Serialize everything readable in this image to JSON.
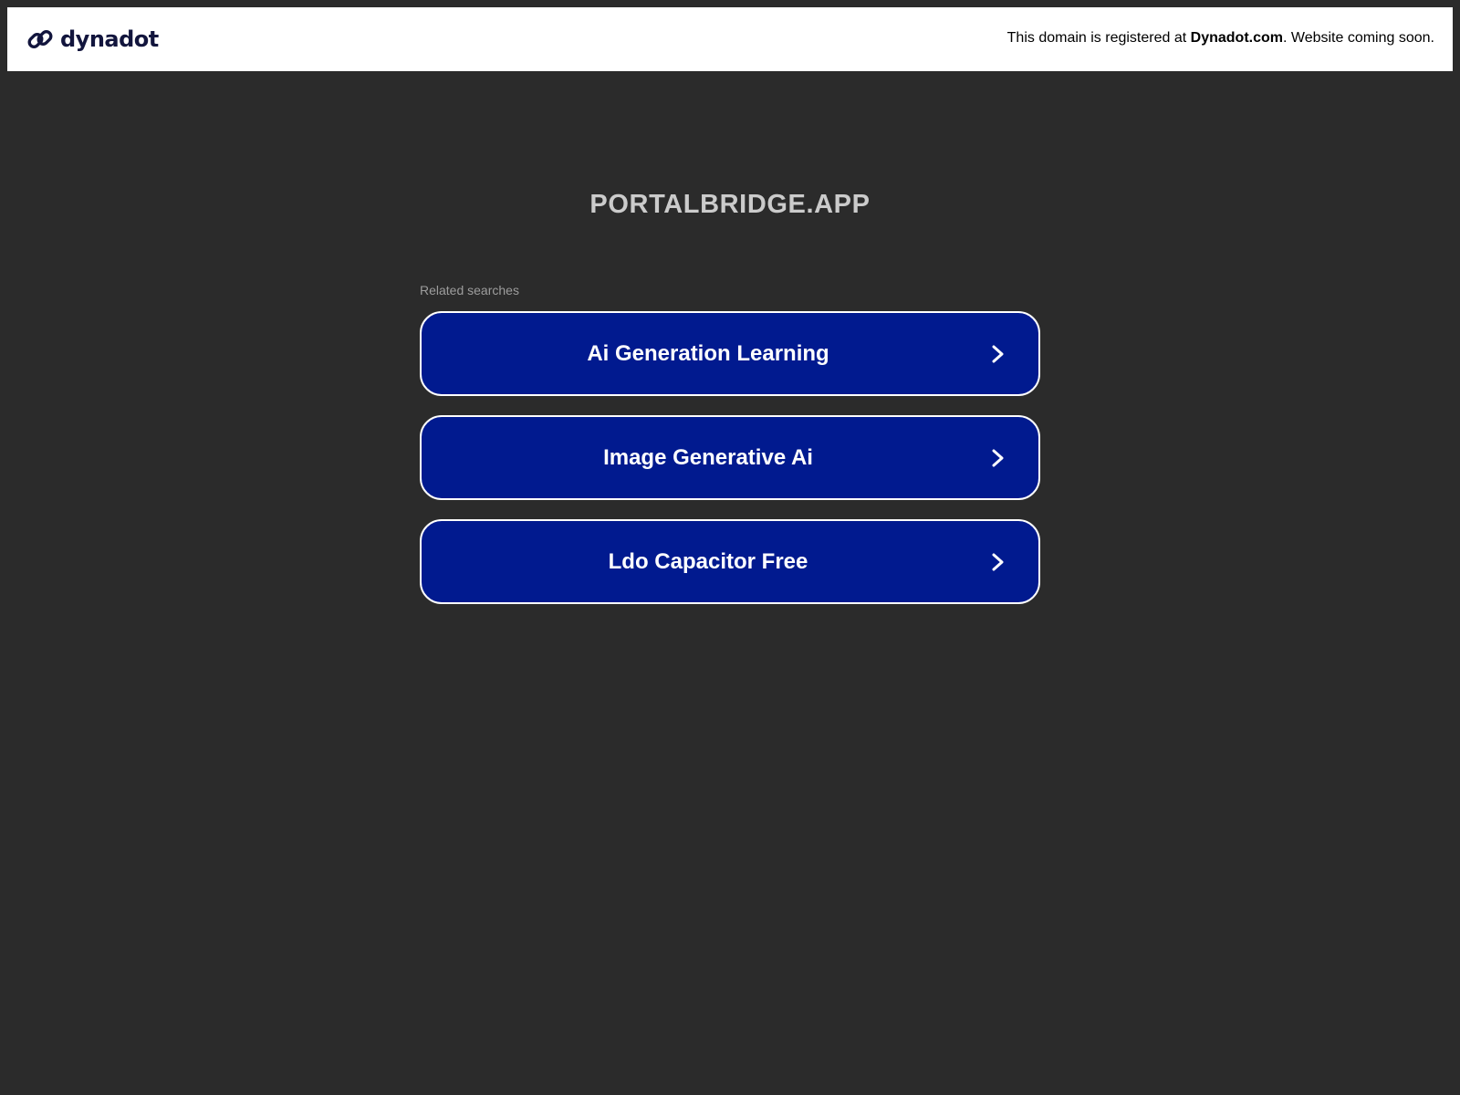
{
  "header": {
    "brand_name": "dynadot",
    "notice_prefix": "This domain is registered at ",
    "notice_link": "Dynadot.com",
    "notice_suffix": ". Website coming soon.",
    "brand_icon": "chain-link-icon"
  },
  "main": {
    "domain": "PORTALBRIDGE.APP",
    "related_label": "Related searches",
    "searches": [
      {
        "label": "Ai Generation Learning",
        "icon": "chevron-right-icon"
      },
      {
        "label": "Image Generative Ai",
        "icon": "chevron-right-icon"
      },
      {
        "label": "Ldo Capacitor Free",
        "icon": "chevron-right-icon"
      }
    ]
  },
  "colors": {
    "page_background": "#2b2b2b",
    "header_background": "#ffffff",
    "button_background": "#011a8f",
    "button_border": "#ffffff",
    "brand_text": "#12153d",
    "domain_text": "#cbcbcb",
    "label_text": "#9d9d9d"
  }
}
